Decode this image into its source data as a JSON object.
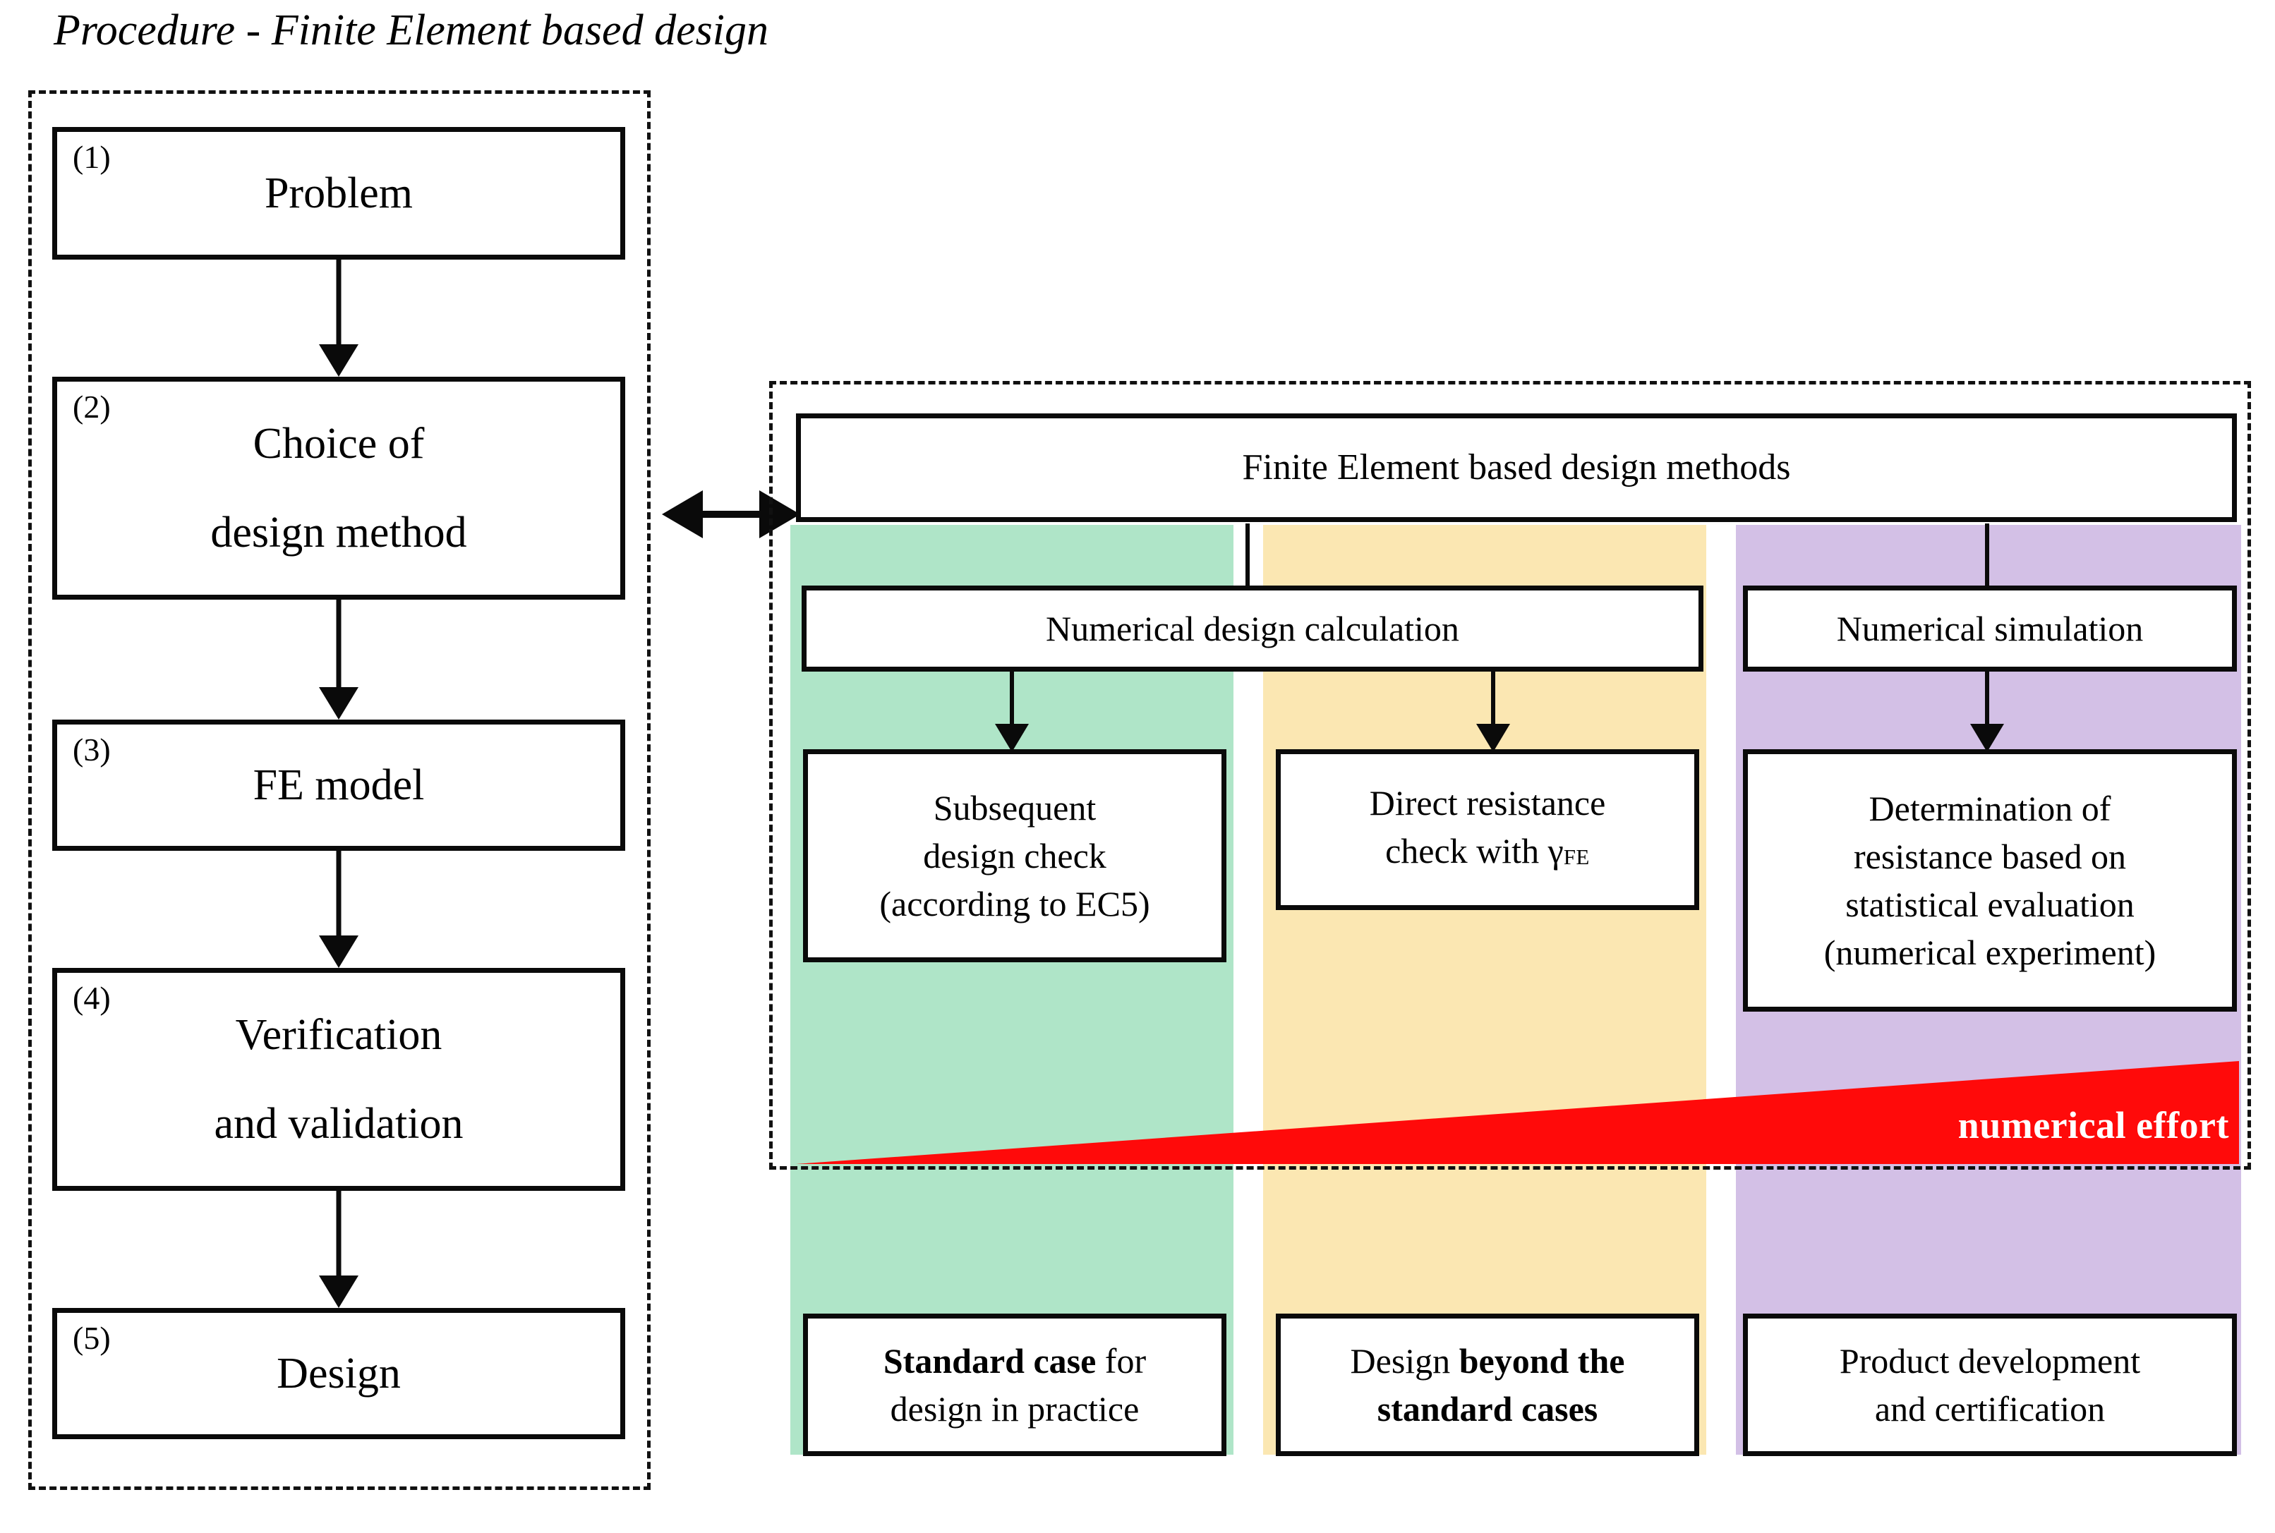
{
  "title": "Procedure - Finite Element based design",
  "colors": {
    "green": "#AFE5C8",
    "yellow": "#FBE7B2",
    "purple": "#D3C0E6",
    "effort_red": "#FF0A0A",
    "outline": "#0A0A0A"
  },
  "procedure": {
    "steps": [
      {
        "number": "(1)",
        "label": "Problem"
      },
      {
        "number": "(2)",
        "line1": "Choice of",
        "line2": "design method"
      },
      {
        "number": "(3)",
        "label": "FE model"
      },
      {
        "number": "(4)",
        "line1": "Verification",
        "line2": "and validation"
      },
      {
        "number": "(5)",
        "label": "Design"
      }
    ]
  },
  "methods_panel": {
    "header": "Finite Element based design methods",
    "columns": [
      {
        "color_name": "green",
        "method": "Numerical design calculation",
        "detail_line1": "Subsequent",
        "detail_line2": "design check",
        "detail_line3": "(according to EC5)",
        "purpose_bold": "Standard case",
        "purpose_rest": " for",
        "purpose_line2": "design in practice"
      },
      {
        "color_name": "yellow",
        "detail_line1": "Direct resistance",
        "detail_line2_prefix": "check with γ",
        "detail_line2_sub": "FE",
        "purpose_prefix": "Design ",
        "purpose_bold_line1": "beyond the",
        "purpose_bold_line2": "standard cases"
      },
      {
        "color_name": "purple",
        "method": "Numerical simulation",
        "detail_line1": "Determination of",
        "detail_line2": "resistance based on",
        "detail_line3": "statistical evaluation",
        "detail_line4": "(numerical experiment)",
        "purpose_line1": "Product development",
        "purpose_line2": "and certification"
      }
    ],
    "effort_label": "numerical effort"
  }
}
